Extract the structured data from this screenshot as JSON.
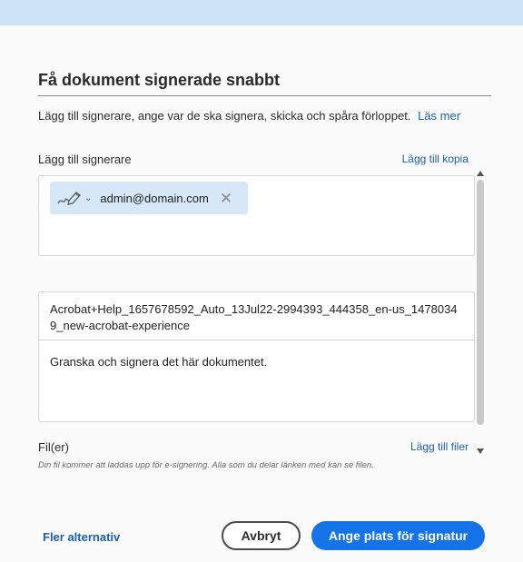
{
  "dialog": {
    "title": "Få dokument signerade snabbt",
    "intro": "Lägg till signerare, ange var de ska signera, skicka och spåra förloppet.",
    "learn_more": "Läs mer"
  },
  "signers": {
    "label": "Lägg till signerare",
    "add_copy": "Lägg till kopia",
    "recipients": [
      {
        "email": "admin@domain.com",
        "role_icon": "signer-pen-icon"
      }
    ]
  },
  "message": {
    "file_name": "Acrobat+Help_1657678592_Auto_13Jul22-2994393_444358_en-us_14780349_new-acrobat-experience",
    "text": "Granska och signera det här dokumentet."
  },
  "files": {
    "label": "Fil(er)",
    "add_files": "Lägg till filer",
    "note": "Din fil kommer att laddas upp för e-signering. Alla som du delar länken med kan se filen."
  },
  "footer": {
    "more_options": "Fler alternativ",
    "cancel": "Avbryt",
    "primary": "Ange plats för signatur"
  },
  "colors": {
    "accent": "#1473e6",
    "link": "#1a5fb4",
    "chip_bg": "#d6e7f8",
    "top_band": "#cfe3f7"
  }
}
